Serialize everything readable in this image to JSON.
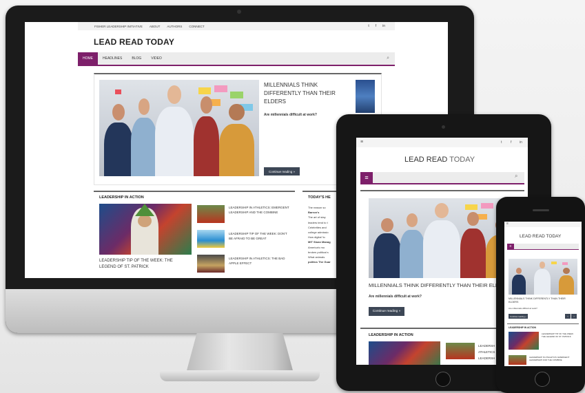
{
  "site": {
    "logo_desktop": "LEAD READ TODAY",
    "logo_tablet_part1": "LEAD READ",
    "logo_tablet_part2": " TODAY",
    "logo_phone": "LEAD READ TODAY"
  },
  "topbar": {
    "links": [
      "FISHER LEADERSHIP INITIATIVE",
      "ABOUT",
      "AUTHORS",
      "CONNECT"
    ],
    "social": [
      "t",
      "f",
      "in"
    ]
  },
  "nav": {
    "items": [
      "HOME",
      "HEADLINES",
      "BLOG",
      "VIDEO"
    ]
  },
  "feature": {
    "title": "MILLENNIALS THINK DIFFERENTLY THAN THEIR ELDERS",
    "subtitle": "Are millennials difficult at work?",
    "button": "Continue reading »"
  },
  "sections": {
    "leadership": "LEADERSHIP IN ACTION",
    "todays": "TODAY'S HE"
  },
  "leadership": {
    "main_title": "LEADERSHIP TIP OF THE WEEK: THE LEGEND OF ST. PATRICK",
    "items": [
      "LEADERSHIP IN ATHLETICS: EMERGENT LEADERSHIP AND THE COMBINE",
      "LEADERSHIP TIP OF THE WEEK: DON'T BE AFRAID TO BE GREAT",
      "LEADERSHIP IN ATHLETICS: THE BAD APPLE EFFECT"
    ]
  },
  "headlines": [
    "The reason so",
    "Barron's",
    "The art of stay",
    "leaders tend to t",
    "Celebrities and",
    "college admissio",
    "How digital 'to",
    "MIT Sloan Manag",
    "America's mo",
    "broken political s",
    "What animals",
    "politics The Guar"
  ],
  "tablet": {
    "feature_title": "MILLENNIALS THINK DIFFERENTLY THAN THEIR ELDE",
    "section": "LEADERSHIP IN ACTION",
    "side_text": [
      "LEADERSH",
      "ATHLETICS",
      "LEADERSH"
    ]
  },
  "phone": {
    "feature_title": "MILLENNIALS THINK DIFFERENTLY THAN THEIR ELDERS",
    "subtitle": "Are millennials difficult at work?",
    "button": "Continue reading »",
    "section": "LEADERSHIP IN ACTION",
    "item1": "LEADERSHIP TIP OF THE WEEK: THE LEGEND OF ST. PATRICK",
    "item2": "LEADERSHIP IN ATHLETICS: EMERGENT LEADERSHIP AND THE COMBINE"
  },
  "colors": {
    "brand": "#7d1f6a",
    "button": "#3d4756"
  }
}
